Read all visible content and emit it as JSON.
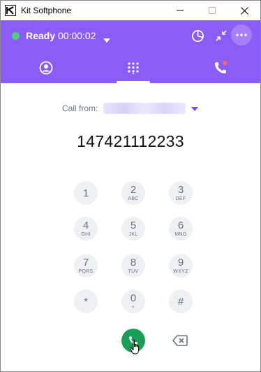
{
  "window": {
    "title": "Kit Softphone"
  },
  "status": {
    "label": "Ready",
    "timer": "00:00:02",
    "dot_color": "#4cd17a"
  },
  "header": {
    "background": "#8b5cf6",
    "icons": [
      "pie-chart-icon",
      "minimize-arrows-icon",
      "more-options-icon"
    ],
    "tabs": [
      {
        "name": "contacts",
        "icon": "contact-icon"
      },
      {
        "name": "dialpad",
        "icon": "dialpad-icon",
        "active": true
      },
      {
        "name": "recent-calls",
        "icon": "phone-notification-icon",
        "badge_color": "#ff6b5a"
      }
    ]
  },
  "dialer": {
    "call_from_label": "Call from:",
    "call_from_value": "",
    "number": "147421112233",
    "keys": [
      {
        "digit": "1",
        "letters": ""
      },
      {
        "digit": "2",
        "letters": "ABC"
      },
      {
        "digit": "3",
        "letters": "DEF"
      },
      {
        "digit": "4",
        "letters": "GHI"
      },
      {
        "digit": "5",
        "letters": "JKL"
      },
      {
        "digit": "6",
        "letters": "MNO"
      },
      {
        "digit": "7",
        "letters": "PQRS"
      },
      {
        "digit": "8",
        "letters": "TUV"
      },
      {
        "digit": "9",
        "letters": "WXYZ"
      },
      {
        "digit": "*",
        "letters": ""
      },
      {
        "digit": "0",
        "letters": "+"
      },
      {
        "digit": "#",
        "letters": ""
      }
    ],
    "call_button_color": "#1a9e55"
  }
}
